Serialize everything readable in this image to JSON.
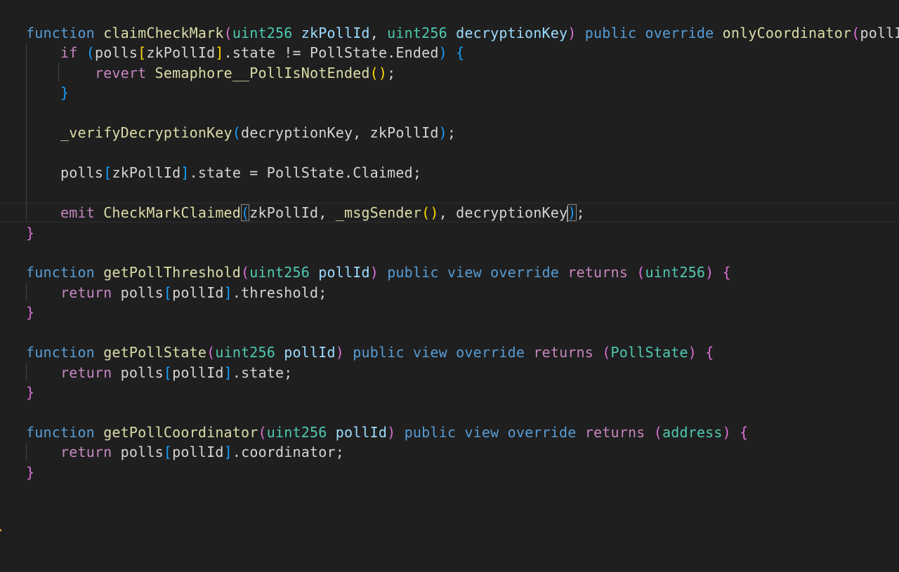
{
  "editor": {
    "language": "solidity",
    "colors": {
      "background": "#1f1f1f",
      "keyword": "#569cd6",
      "control": "#c586c0",
      "function": "#dcdcaa",
      "type": "#4ec9b0",
      "parameter": "#9cdcfe",
      "text": "#d4d4d4",
      "bracket_gold": "#ffd700",
      "bracket_orchid": "#da70d6",
      "bracket_blue": "#179fff"
    },
    "lines": [
      [
        {
          "t": "function",
          "c": "kw-blue"
        },
        {
          "t": " ",
          "c": "plain"
        },
        {
          "t": "claimCheckMark",
          "c": "fn"
        },
        {
          "t": "(",
          "c": "b2"
        },
        {
          "t": "uint256",
          "c": "ty"
        },
        {
          "t": " ",
          "c": "plain"
        },
        {
          "t": "zkPollId",
          "c": "par"
        },
        {
          "t": ", ",
          "c": "plain"
        },
        {
          "t": "uint256",
          "c": "ty"
        },
        {
          "t": " ",
          "c": "plain"
        },
        {
          "t": "decryptionKey",
          "c": "par"
        },
        {
          "t": ")",
          "c": "b2"
        },
        {
          "t": " ",
          "c": "plain"
        },
        {
          "t": "public",
          "c": "kw-blue"
        },
        {
          "t": " ",
          "c": "plain"
        },
        {
          "t": "override",
          "c": "kw-blue"
        },
        {
          "t": " ",
          "c": "plain"
        },
        {
          "t": "onlyCoordinator",
          "c": "fn"
        },
        {
          "t": "(",
          "c": "b2"
        },
        {
          "t": "pollId",
          "c": "plain"
        },
        {
          "t": ")",
          "c": "b2"
        },
        {
          "t": " ",
          "c": "plain"
        },
        {
          "t": "{",
          "c": "b2"
        }
      ],
      [
        {
          "t": "    ",
          "c": "plain"
        },
        {
          "t": "if",
          "c": "kw-pink"
        },
        {
          "t": " ",
          "c": "plain"
        },
        {
          "t": "(",
          "c": "b3"
        },
        {
          "t": "polls",
          "c": "plain"
        },
        {
          "t": "[",
          "c": "b1"
        },
        {
          "t": "zkPollId",
          "c": "plain"
        },
        {
          "t": "]",
          "c": "b1"
        },
        {
          "t": ".state != PollState.Ended",
          "c": "plain"
        },
        {
          "t": ")",
          "c": "b3"
        },
        {
          "t": " ",
          "c": "plain"
        },
        {
          "t": "{",
          "c": "b3"
        }
      ],
      [
        {
          "t": "        ",
          "c": "plain"
        },
        {
          "t": "revert",
          "c": "kw-pink"
        },
        {
          "t": " ",
          "c": "plain"
        },
        {
          "t": "Semaphore__PollIsNotEnded",
          "c": "fn"
        },
        {
          "t": "()",
          "c": "b1"
        },
        {
          "t": ";",
          "c": "plain"
        }
      ],
      [
        {
          "t": "    ",
          "c": "plain"
        },
        {
          "t": "}",
          "c": "b3"
        }
      ],
      [],
      [
        {
          "t": "    ",
          "c": "plain"
        },
        {
          "t": "_verifyDecryptionKey",
          "c": "fn"
        },
        {
          "t": "(",
          "c": "b3"
        },
        {
          "t": "decryptionKey, zkPollId",
          "c": "plain"
        },
        {
          "t": ")",
          "c": "b3"
        },
        {
          "t": ";",
          "c": "plain"
        }
      ],
      [],
      [
        {
          "t": "    ",
          "c": "plain"
        },
        {
          "t": "polls",
          "c": "plain"
        },
        {
          "t": "[",
          "c": "b3"
        },
        {
          "t": "zkPollId",
          "c": "plain"
        },
        {
          "t": "]",
          "c": "b3"
        },
        {
          "t": ".state = PollState.Claimed;",
          "c": "plain"
        }
      ],
      [],
      [
        {
          "t": "    ",
          "c": "plain"
        },
        {
          "t": "emit",
          "c": "kw-pink"
        },
        {
          "t": " ",
          "c": "plain"
        },
        {
          "t": "CheckMarkClaimed",
          "c": "fn"
        },
        {
          "t": "(",
          "c": "b3",
          "match": true
        },
        {
          "t": "zkPollId, ",
          "c": "plain"
        },
        {
          "t": "_msgSender",
          "c": "fn"
        },
        {
          "t": "()",
          "c": "b1"
        },
        {
          "t": ", decryptionKey",
          "c": "plain"
        },
        {
          "t": ")",
          "c": "b3",
          "match": true,
          "cursor": true
        },
        {
          "t": ";",
          "c": "plain"
        }
      ],
      [
        {
          "t": "}",
          "c": "b2"
        }
      ],
      [],
      [
        {
          "t": "function",
          "c": "kw-blue"
        },
        {
          "t": " ",
          "c": "plain"
        },
        {
          "t": "getPollThreshold",
          "c": "fn"
        },
        {
          "t": "(",
          "c": "b2"
        },
        {
          "t": "uint256",
          "c": "ty"
        },
        {
          "t": " ",
          "c": "plain"
        },
        {
          "t": "pollId",
          "c": "par"
        },
        {
          "t": ")",
          "c": "b2"
        },
        {
          "t": " ",
          "c": "plain"
        },
        {
          "t": "public",
          "c": "kw-blue"
        },
        {
          "t": " ",
          "c": "plain"
        },
        {
          "t": "view",
          "c": "kw-blue"
        },
        {
          "t": " ",
          "c": "plain"
        },
        {
          "t": "override",
          "c": "kw-blue"
        },
        {
          "t": " ",
          "c": "plain"
        },
        {
          "t": "returns",
          "c": "kw-pink"
        },
        {
          "t": " ",
          "c": "plain"
        },
        {
          "t": "(",
          "c": "b2"
        },
        {
          "t": "uint256",
          "c": "ty"
        },
        {
          "t": ")",
          "c": "b2"
        },
        {
          "t": " ",
          "c": "plain"
        },
        {
          "t": "{",
          "c": "b2"
        }
      ],
      [
        {
          "t": "    ",
          "c": "plain"
        },
        {
          "t": "return",
          "c": "kw-pink"
        },
        {
          "t": " ",
          "c": "plain"
        },
        {
          "t": "polls",
          "c": "plain"
        },
        {
          "t": "[",
          "c": "b3"
        },
        {
          "t": "pollId",
          "c": "plain"
        },
        {
          "t": "]",
          "c": "b3"
        },
        {
          "t": ".threshold;",
          "c": "plain"
        }
      ],
      [
        {
          "t": "}",
          "c": "b2"
        }
      ],
      [],
      [
        {
          "t": "function",
          "c": "kw-blue"
        },
        {
          "t": " ",
          "c": "plain"
        },
        {
          "t": "getPollState",
          "c": "fn"
        },
        {
          "t": "(",
          "c": "b2"
        },
        {
          "t": "uint256",
          "c": "ty"
        },
        {
          "t": " ",
          "c": "plain"
        },
        {
          "t": "pollId",
          "c": "par"
        },
        {
          "t": ")",
          "c": "b2"
        },
        {
          "t": " ",
          "c": "plain"
        },
        {
          "t": "public",
          "c": "kw-blue"
        },
        {
          "t": " ",
          "c": "plain"
        },
        {
          "t": "view",
          "c": "kw-blue"
        },
        {
          "t": " ",
          "c": "plain"
        },
        {
          "t": "override",
          "c": "kw-blue"
        },
        {
          "t": " ",
          "c": "plain"
        },
        {
          "t": "returns",
          "c": "kw-pink"
        },
        {
          "t": " ",
          "c": "plain"
        },
        {
          "t": "(",
          "c": "b2"
        },
        {
          "t": "PollState",
          "c": "ty"
        },
        {
          "t": ")",
          "c": "b2"
        },
        {
          "t": " ",
          "c": "plain"
        },
        {
          "t": "{",
          "c": "b2"
        }
      ],
      [
        {
          "t": "    ",
          "c": "plain"
        },
        {
          "t": "return",
          "c": "kw-pink"
        },
        {
          "t": " ",
          "c": "plain"
        },
        {
          "t": "polls",
          "c": "plain"
        },
        {
          "t": "[",
          "c": "b3"
        },
        {
          "t": "pollId",
          "c": "plain"
        },
        {
          "t": "]",
          "c": "b3"
        },
        {
          "t": ".state;",
          "c": "plain"
        }
      ],
      [
        {
          "t": "}",
          "c": "b2"
        }
      ],
      [],
      [
        {
          "t": "function",
          "c": "kw-blue"
        },
        {
          "t": " ",
          "c": "plain"
        },
        {
          "t": "getPollCoordinator",
          "c": "fn"
        },
        {
          "t": "(",
          "c": "b2"
        },
        {
          "t": "uint256",
          "c": "ty"
        },
        {
          "t": " ",
          "c": "plain"
        },
        {
          "t": "pollId",
          "c": "par"
        },
        {
          "t": ")",
          "c": "b2"
        },
        {
          "t": " ",
          "c": "plain"
        },
        {
          "t": "public",
          "c": "kw-blue"
        },
        {
          "t": " ",
          "c": "plain"
        },
        {
          "t": "view",
          "c": "kw-blue"
        },
        {
          "t": " ",
          "c": "plain"
        },
        {
          "t": "override",
          "c": "kw-blue"
        },
        {
          "t": " ",
          "c": "plain"
        },
        {
          "t": "returns",
          "c": "kw-pink"
        },
        {
          "t": " ",
          "c": "plain"
        },
        {
          "t": "(",
          "c": "b2"
        },
        {
          "t": "address",
          "c": "ty"
        },
        {
          "t": ")",
          "c": "b2"
        },
        {
          "t": " ",
          "c": "plain"
        },
        {
          "t": "{",
          "c": "b2"
        }
      ],
      [
        {
          "t": "    ",
          "c": "plain"
        },
        {
          "t": "return",
          "c": "kw-pink"
        },
        {
          "t": " ",
          "c": "plain"
        },
        {
          "t": "polls",
          "c": "plain"
        },
        {
          "t": "[",
          "c": "b3"
        },
        {
          "t": "pollId",
          "c": "plain"
        },
        {
          "t": "]",
          "c": "b3"
        },
        {
          "t": ".coordinator;",
          "c": "plain"
        }
      ],
      [
        {
          "t": "}",
          "c": "b2"
        }
      ]
    ]
  }
}
